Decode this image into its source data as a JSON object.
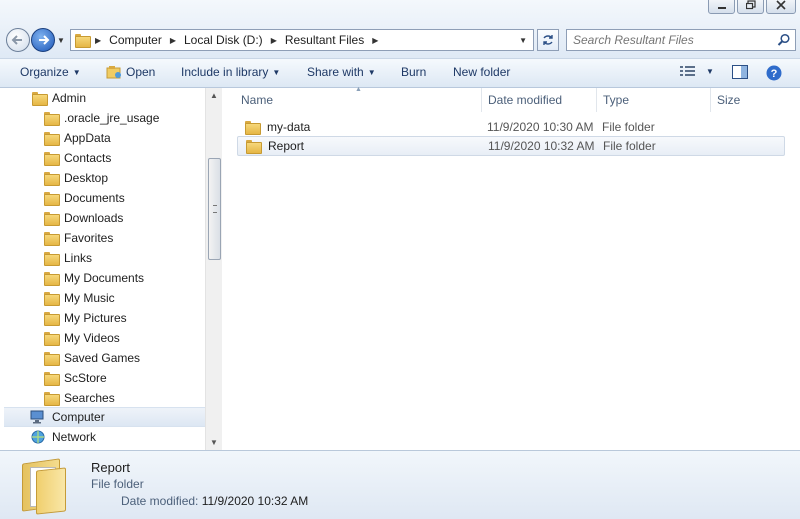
{
  "address": {
    "crumbs": [
      "Computer",
      "Local Disk (D:)",
      "Resultant Files"
    ]
  },
  "search": {
    "placeholder": "Search Resultant Files"
  },
  "toolbar": {
    "organize": "Organize",
    "open": "Open",
    "include_in_library": "Include in library",
    "share_with": "Share with",
    "burn": "Burn",
    "new_folder": "New folder"
  },
  "nav": {
    "root": "Admin",
    "items": [
      ".oracle_jre_usage",
      "AppData",
      "Contacts",
      "Desktop",
      "Documents",
      "Downloads",
      "Favorites",
      "Links",
      "My Documents",
      "My Music",
      "My Pictures",
      "My Videos",
      "Saved Games",
      "ScStore",
      "Searches"
    ],
    "computer": "Computer",
    "network": "Network"
  },
  "columns": {
    "name": "Name",
    "date": "Date modified",
    "type": "Type",
    "size": "Size"
  },
  "files": [
    {
      "name": "my-data",
      "date": "11/9/2020 10:30 AM",
      "type": "File folder"
    },
    {
      "name": "Report",
      "date": "11/9/2020 10:32 AM",
      "type": "File folder"
    }
  ],
  "details": {
    "name": "Report",
    "type": "File folder",
    "date_label": "Date modified:",
    "date_value": "11/9/2020 10:32 AM"
  },
  "colors": {
    "accent": "#1e3966",
    "selection": "#e8eef6",
    "chrome": "#dfe9f5"
  }
}
